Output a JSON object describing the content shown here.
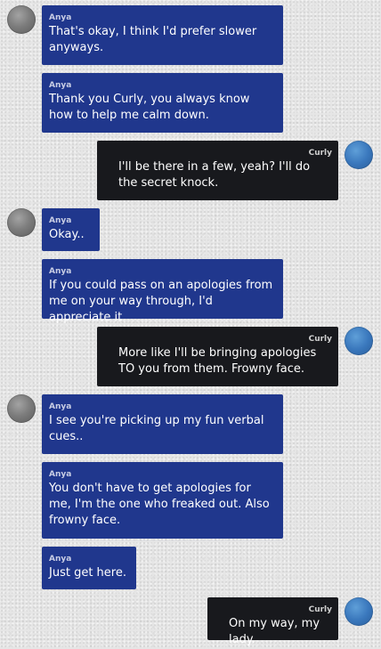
{
  "conversation": {
    "messages": [
      {
        "sender": "Anya",
        "text": "That's okay, I think I'd prefer slower anyways."
      },
      {
        "sender": "Anya",
        "text": "Thank you Curly, you always know how to help me calm down."
      },
      {
        "sender": "Curly",
        "text": "I'll be there in a few, yeah? I'll do the secret knock."
      },
      {
        "sender": "Anya",
        "text": "Okay.."
      },
      {
        "sender": "Anya",
        "text": "If you could pass on an apologies from me on your way through, I'd appreciate it"
      },
      {
        "sender": "Curly",
        "text": "More like I'll be bringing apologies TO you from them. Frowny face."
      },
      {
        "sender": "Anya",
        "text": "I see you're picking up my fun verbal cues.."
      },
      {
        "sender": "Anya",
        "text": "You don't have to get apologies for me, I'm the one who freaked out. Also frowny face."
      },
      {
        "sender": "Anya",
        "text": "Just get here."
      },
      {
        "sender": "Curly",
        "text": "On my way, my lady."
      }
    ]
  },
  "colors": {
    "anya_bubble": "#20378d",
    "curly_bubble": "#18191d",
    "background": "#e6e6e6"
  },
  "icons": {
    "anya_avatar": "gray-avatar-icon",
    "curly_avatar": "blue-avatar-icon"
  }
}
